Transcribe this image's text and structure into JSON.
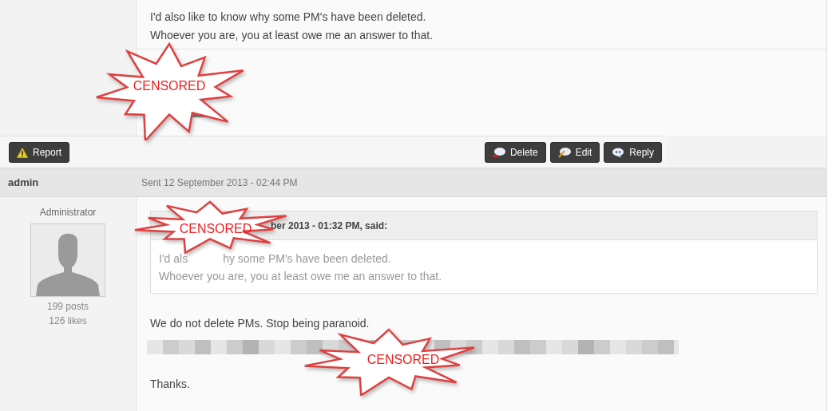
{
  "top_post": {
    "lines": [
      "I'd also like to know why some PM's have been deleted.",
      "Whoever you are, you at least owe me an answer to that."
    ]
  },
  "actions": {
    "left": [
      {
        "label": "Report",
        "kind": "report"
      }
    ],
    "right": [
      {
        "label": "Delete",
        "kind": "delete"
      },
      {
        "label": "Edit",
        "kind": "edit"
      },
      {
        "label": "Reply",
        "kind": "reply"
      }
    ]
  },
  "post": {
    "author": "admin",
    "sent": "Sent 12 September 2013 - 02:44 PM",
    "role": "Administrator",
    "posts": "199 posts",
    "likes": "126 likes",
    "quote": {
      "header": "ber 2013 - 01:32 PM, said:",
      "line_1": [
        "I'd als",
        "hy some PM's have been deleted."
      ],
      "line_2": "Whoever you are, you at least owe me an answer to that."
    },
    "body": [
      "We do not delete PMs. Stop being paranoid.",
      "Thanks."
    ]
  },
  "stamps": [
    {
      "text": "CENSORED"
    },
    {
      "text": "CENSORED"
    },
    {
      "text": "CENSORED"
    }
  ]
}
